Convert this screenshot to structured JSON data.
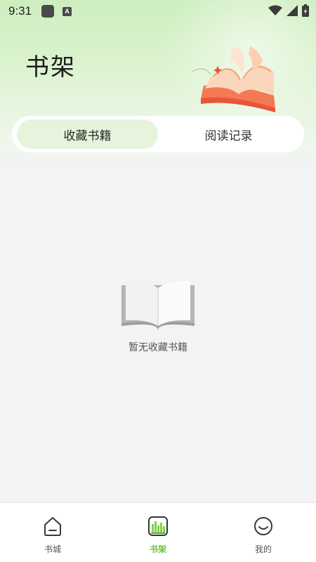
{
  "status_bar": {
    "time": "9:31",
    "indicator_letter": "A"
  },
  "header": {
    "title": "书架"
  },
  "tabs": [
    {
      "label": "收藏书籍",
      "active": true
    },
    {
      "label": "阅读记录",
      "active": false
    }
  ],
  "empty_state": {
    "message": "暂无收藏书籍"
  },
  "bottom_nav": [
    {
      "label": "书城",
      "icon": "home-icon",
      "active": false
    },
    {
      "label": "书架",
      "icon": "bookshelf-icon",
      "active": true
    },
    {
      "label": "我的",
      "icon": "profile-icon",
      "active": false
    }
  ],
  "colors": {
    "accent": "#6cc13a",
    "header_green": "#cdeebf",
    "active_tab": "#e6f3dd",
    "book_orange": "#f07a4e"
  }
}
